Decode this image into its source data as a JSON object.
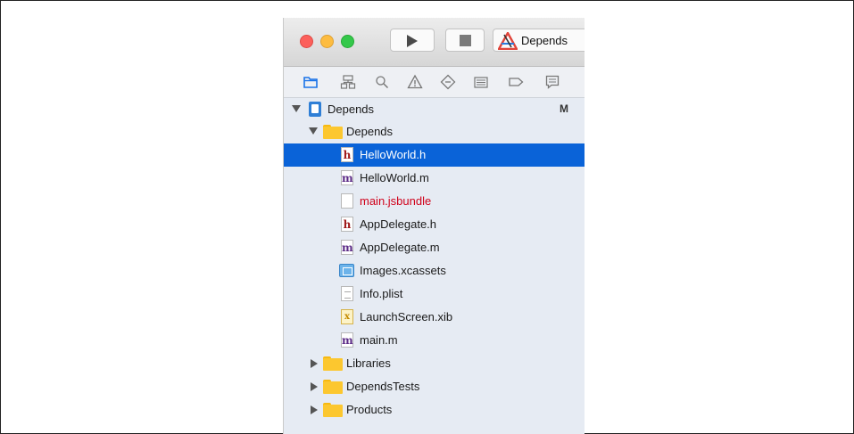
{
  "toolbar": {
    "scheme_label": "Depends",
    "traffic_lights": [
      "close",
      "minimize",
      "zoom"
    ]
  },
  "navigator_icons": [
    "project-navigator-icon",
    "symbol-navigator-icon",
    "find-navigator-icon",
    "issue-navigator-icon",
    "test-navigator-icon",
    "debug-navigator-icon",
    "breakpoint-navigator-icon",
    "report-navigator-icon"
  ],
  "tree": {
    "project": {
      "label": "Depends",
      "badge": "M"
    },
    "group": {
      "label": "Depends"
    },
    "files": [
      {
        "label": "HelloWorld.h",
        "kind": "h",
        "selected": true
      },
      {
        "label": "HelloWorld.m",
        "kind": "m"
      },
      {
        "label": "main.jsbundle",
        "kind": "blank",
        "missing": true
      },
      {
        "label": "AppDelegate.h",
        "kind": "h"
      },
      {
        "label": "AppDelegate.m",
        "kind": "m"
      },
      {
        "label": "Images.xcassets",
        "kind": "assets"
      },
      {
        "label": "Info.plist",
        "kind": "plist"
      },
      {
        "label": "LaunchScreen.xib",
        "kind": "xib"
      },
      {
        "label": "main.m",
        "kind": "m"
      }
    ],
    "groups": [
      {
        "label": "Libraries"
      },
      {
        "label": "DependsTests"
      },
      {
        "label": "Products"
      }
    ]
  },
  "colors": {
    "selection": "#0a63d8",
    "missing_file": "#d0021b",
    "folder": "#fcc72f",
    "active_nav": "#1a73e8"
  }
}
